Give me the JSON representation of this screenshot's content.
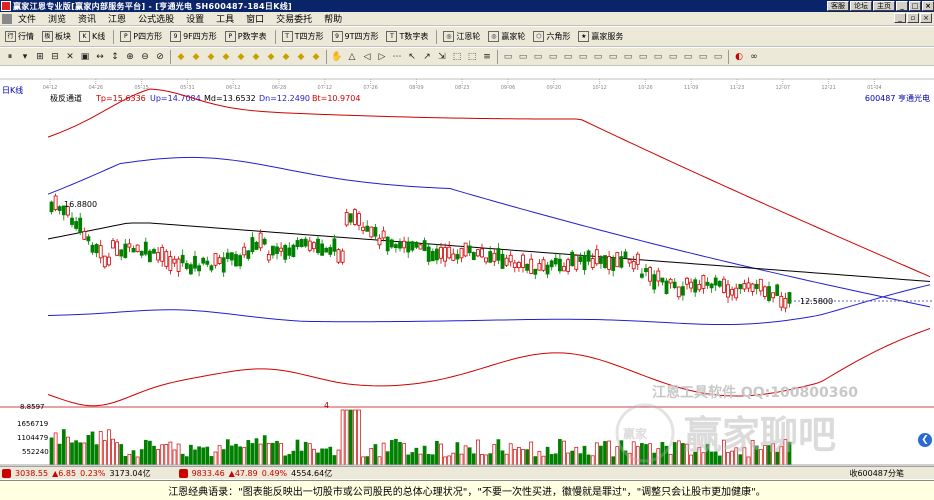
{
  "titlebar": {
    "title": "赢家江恩专业版[赢家内部服务平台] - [亨通光电   SH600487-184日K线]",
    "buttons": [
      "客服",
      "论坛",
      "主页"
    ],
    "window_controls": [
      "_",
      "□",
      "×"
    ]
  },
  "menubar": {
    "items": [
      "文件",
      "浏览",
      "资讯",
      "江恩",
      "公式选股",
      "设置",
      "工具",
      "窗口",
      "交易委托",
      "帮助"
    ],
    "right": [
      "_",
      "▫",
      "×"
    ]
  },
  "toolbar1": {
    "items": [
      {
        "icon": "行",
        "label": "行情"
      },
      {
        "icon": "板",
        "label": "板块"
      },
      {
        "icon": "K",
        "label": "K线"
      },
      {
        "icon": "P",
        "label": "P四方形"
      },
      {
        "icon": "9",
        "label": "9F四方形"
      },
      {
        "icon": "P",
        "label": "P数字表"
      },
      {
        "icon": "T",
        "label": "T四方形"
      },
      {
        "icon": "9",
        "label": "9T四方形"
      },
      {
        "icon": "T",
        "label": "T数字表"
      },
      {
        "icon": "◎",
        "label": "江恩轮"
      },
      {
        "icon": "◎",
        "label": "赢家轮"
      },
      {
        "icon": "⬡",
        "label": "六角形"
      },
      {
        "icon": "★",
        "label": "赢家服务"
      }
    ]
  },
  "toolbar2": {
    "icons": [
      "⏸",
      "▾",
      "⊞",
      "⊟",
      "✕",
      "▣",
      "↔",
      "↕",
      "⊕",
      "⊖",
      "⊘",
      "│",
      "◆",
      "◆",
      "◆",
      "◆",
      "◆",
      "◆",
      "◆",
      "◆",
      "◆",
      "◆",
      "│",
      "✋",
      "△",
      "◁",
      "▷",
      "⋯",
      "↖",
      "↗",
      "⇲",
      "⬚",
      "⬚",
      "≡",
      "│",
      "▭",
      "▭",
      "▭",
      "▭",
      "▭",
      "▭",
      "▭",
      "▭",
      "▭",
      "▭",
      "▭",
      "▭",
      "▭",
      "▭",
      "▭",
      "│",
      "◐",
      "∞"
    ]
  },
  "chart": {
    "period_label": "日K线",
    "indicator_name": "极反通道",
    "tp": "Tp=15.6336",
    "up": "Up=14.7084",
    "md": "Md=13.6532",
    "dn": "Dn=12.2490",
    "bt": "Bt=10.9704",
    "stock": "600487   亨通光电",
    "high_label": "16.8800",
    "low_label": "12.5800",
    "watermark_top": "江恩工具软件  QQ:100800360",
    "watermark_bottom": "赢家聊吧",
    "x_dates": [
      "04-12",
      "04-26",
      "05-15",
      "05-31",
      "06-12",
      "06-28",
      "07-12",
      "07-26",
      "08-09",
      "08-23",
      "09-06",
      "09-20",
      "10-12",
      "10-26",
      "11-09",
      "11-23",
      "12-07",
      "12-21",
      "01-04"
    ],
    "vol_axis": [
      "8.8597",
      "1656719",
      "1104479",
      "552240"
    ],
    "marker": "4"
  },
  "statusbar": {
    "sh": "3038.55",
    "sh_chg": "▲6.85",
    "sh_pct": "0.23%",
    "sh_amt": "3173.04亿",
    "sz": "9833.46",
    "sz_chg": "▲47.89",
    "sz_pct": "0.49%",
    "sz_amt": "4554.64亿",
    "right": "收600487分笔"
  },
  "footer": {
    "quote": "江恩经典语录：\"图表能反映出一切股市或公司股民的总体心理状况\"，\"不要一次性买进，徽慢就是罪过\"，\"调整只会让股市更加健康\"。"
  },
  "chart_data": {
    "type": "candlestick",
    "colors": {
      "up": "#d00000",
      "down": "#008000",
      "tp": "#d00000",
      "up_band": "#2020d0",
      "md": "#000000",
      "dn": "#2020d0",
      "bt": "#d00000"
    }
  }
}
